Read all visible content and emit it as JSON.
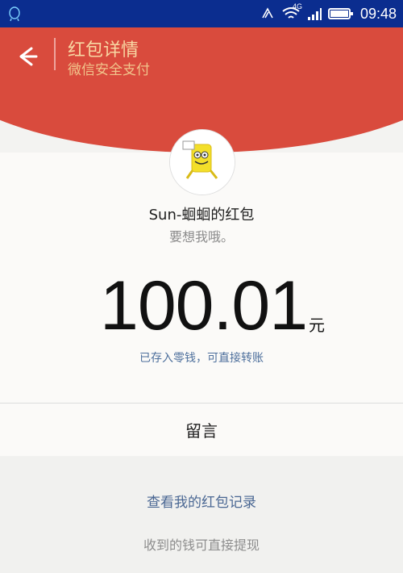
{
  "status_bar": {
    "left_icon": "qq-icon",
    "network": "4G",
    "time": "09:48",
    "icons": [
      "nfc-icon",
      "wifi-icon",
      "signal-icon",
      "battery-icon"
    ]
  },
  "header": {
    "back_icon": "back-arrow-icon",
    "title": "红包详情",
    "subtitle": "微信安全支付",
    "accent_color": "#d94b3d"
  },
  "envelope": {
    "avatar_name": "avatar",
    "sender": "Sun-蛔蛔的红包",
    "message": "要想我哦。",
    "amount": "100.01",
    "unit": "元",
    "status_text": "已存入零钱，可直接转账"
  },
  "actions": {
    "message_button": "留言",
    "history_link": "查看我的红包记录",
    "withdraw_note": "收到的钱可直接提现"
  }
}
